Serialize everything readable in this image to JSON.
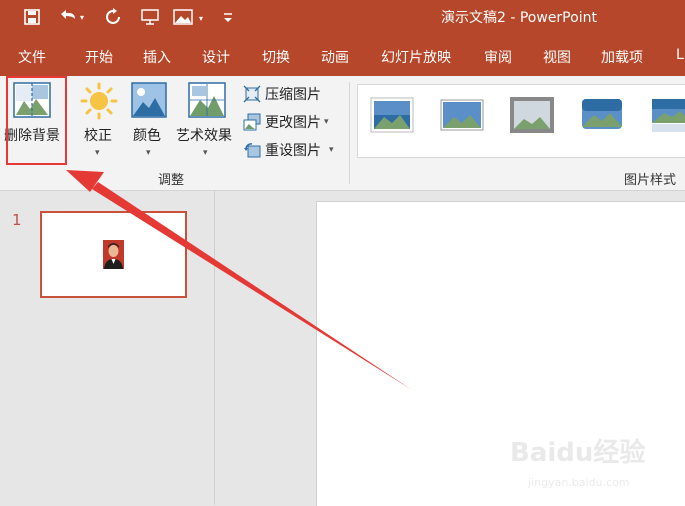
{
  "window": {
    "title": "演示文稿2  -  PowerPoint"
  },
  "qat": {
    "icons": [
      "save-icon",
      "undo-icon",
      "redo-icon",
      "present-from-start-icon",
      "insert-picture-icon",
      "customize-qat-icon"
    ]
  },
  "tabs": [
    {
      "label": "文件"
    },
    {
      "label": "开始"
    },
    {
      "label": "插入"
    },
    {
      "label": "设计"
    },
    {
      "label": "切换"
    },
    {
      "label": "动画"
    },
    {
      "label": "幻灯片放映"
    },
    {
      "label": "审阅"
    },
    {
      "label": "视图"
    },
    {
      "label": "加载项"
    },
    {
      "label": "L"
    }
  ],
  "ribbon": {
    "remove_bg": "删除背景",
    "corrections": "校正",
    "color": "颜色",
    "artistic": "艺术效果",
    "compress": "压缩图片",
    "change": "更改图片",
    "reset": "重设图片",
    "adjust_group": "调整",
    "styles_group": "图片样式"
  },
  "slides_pane": {
    "slide_number": "1"
  },
  "colors": {
    "accent": "#b7472a",
    "annotation": "#e53935"
  },
  "watermark": {
    "brand": "Baidu经验",
    "url": "jingyan.baidu.com"
  }
}
